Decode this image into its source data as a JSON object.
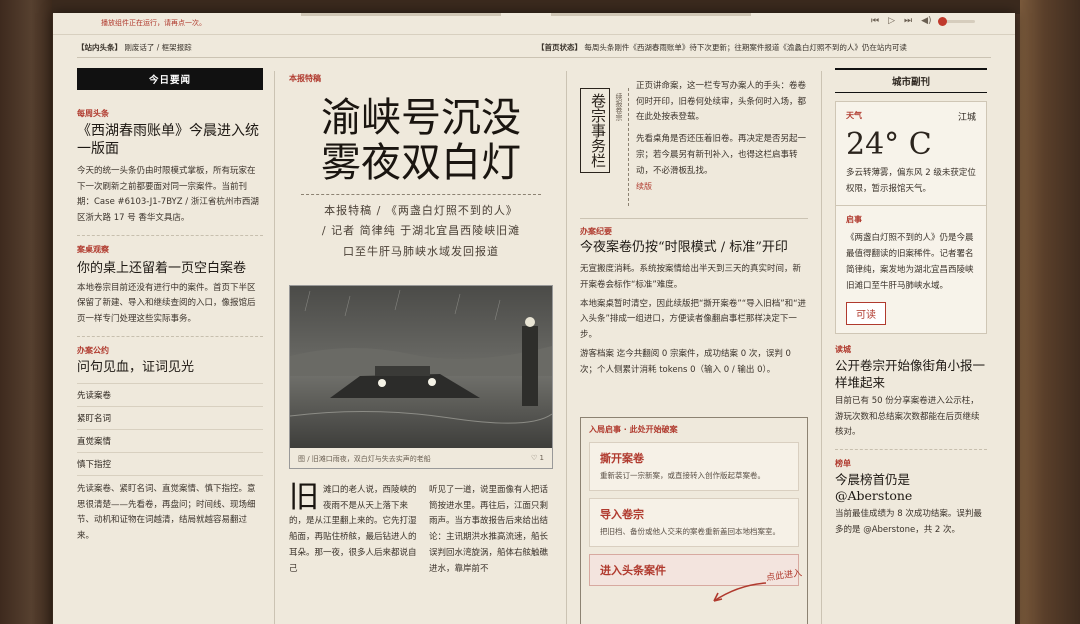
{
  "topbar": {
    "note": "播放组件正在运行，请再点一次。"
  },
  "player": {
    "prev": "⏮",
    "play": "▷",
    "next": "⏭",
    "volume_icon": "◀)"
  },
  "ticker": {
    "left_label": "【站内头条】",
    "left_text": "刚废话了 / 框架报踪",
    "right_label": "【首页状态】",
    "right_text": "每周头条刚件《西湖春雨账单》待下次更新；往期案件报道《渝蠡白灯照不到的人》仍在站内可读"
  },
  "left": {
    "section": "今日要闻",
    "blocks": [
      {
        "tag": "每周头条",
        "title": "《西湖春雨账单》今晨进入统一版面",
        "body": "今天的统一头条仍由时限模式掌板，所有玩家在下一次刷新之前都要面对同一宗案件。当前刊期：Case #6103-J1-7BYZ / 浙江省杭州市西湖区浙大路 17 号 香华文具店。"
      },
      {
        "tag": "案桌观察",
        "title": "你的桌上还留着一页空白案卷",
        "body": "本地卷宗目前还没有进行中的案件。首页下半区保留了新建、导入和继续查阅的入口，像报馆后页一样专门处理这些实际事务。"
      },
      {
        "tag": "办案公约",
        "title": "问句见血，证词见光",
        "body": ""
      }
    ],
    "list": [
      "先读案卷",
      "紧盯名词",
      "直觉案情",
      "慎下指控"
    ],
    "tail": "先读案卷、紧盯名词、直觉案情、慎下指控。意思很清楚——先看卷，再盘问；时间线、现场细节、动机和证物在词越清，结局就越容易翻过来。"
  },
  "feature": {
    "tag": "本报特稿",
    "headline_1": "渝峡号沉没",
    "headline_2": "雾夜双白灯",
    "byline_1": "本报特稿 / 《两盏白灯照不到的人》",
    "byline_2": "/ 记者 简律纯 于湖北宜昌西陵峡旧滩",
    "byline_3": "口至牛肝马肺峡水域发回报道",
    "photo_caption": "图 / 旧滩口雨夜，双白灯与失去实声的老船",
    "photo_stat": "♡  1",
    "dropcap": "旧",
    "col1": "滩口的老人说，西陵峡的夜雨不是从天上落下来的，是从江里翻上来的。它先打湿船面，再贴住桥舷，最后钻进人的耳朵。那一夜，很多人后来都说自己",
    "col2": "听见了一道，说里面像有人把话筒按进水里。再往后，江面只剩雨声。当方事故报告后来给出结论：主讯期洪水推高流速，船长误判回水湾旋涡，船体右舷触礁进水，靠岸前不"
  },
  "column": {
    "vertical_title": "卷宗事务栏",
    "vertical_sub": "续报卷宗",
    "intro_1": "正页讲命案，这一栏专写办案人的手头：卷卷何时开印，旧卷何处续审，头条何时入场，都在此处按表登载。",
    "intro_2": "先看桌角是否还压着旧卷。再决定是否另起一宗；若今晨另有新刊补入，也得这栏启事转动，不必滑板乱找。",
    "more": "续版",
    "notice_tag": "办案纪要",
    "notice_title": "今夜案卷仍按“时限模式 / 标准”开印",
    "notice_p1": "无宣搬度消耗。系统按案情给出半天到三天的真实时间，新开案卷会标作“标准”难度。",
    "notice_p2": "本地案桌暂时清空，因此续版把“撕开案卷”“导入旧档”和“进入头条”排成一组进口，方便读者像翻启事栏那样决定下一步。",
    "notice_p3": "游客档案 迄今共翻阅 0 宗案件，成功结案 0 次，误判 0 次；个人侧累计消耗 tokens 0（输入 0 / 输出 0）。",
    "entry_head": "入局启事 · 此处开始破案",
    "cards": [
      {
        "title": "撕开案卷",
        "desc": "重新装订一宗新案，或直接转入创作版起草案卷。"
      },
      {
        "title": "导入卷宗",
        "desc": "把旧档、备份或他人交来的案卷重新盖回本地档案室。"
      },
      {
        "title": "进入头条案件",
        "desc": ""
      }
    ],
    "annotation": "点此进入"
  },
  "right": {
    "section": "城市副刊",
    "weather_tag": "天气",
    "weather_city": "江城",
    "temp": "24°  C",
    "weather_desc": "多云转薄雾，偏东风 2 级未获定位权限，暂示报馆天气。",
    "notice_tag": "启事",
    "notice_body": "《两盏白灯照不到的人》仍是今晨最值得翻读的旧案稀件。记者署名 简律纯，案发地为湖北宜昌西陵峡旧滩口至牛肝马肺峡水域。",
    "notice_btn": "可读",
    "reader_tag": "读城",
    "reader_title": "公开卷宗开始像街角小报一样堆起来",
    "reader_body": "目前已有 50 份分享案卷进入公示柱，游玩次数和总结案次数都能在后页继续核对。",
    "rank_tag": "榜单",
    "rank_title": "今晨榜首仍是 @Aberstone",
    "rank_body": "当前最佳成绩为 8 次成功结案。误判最多的是 @Aberstone，共 2 次。"
  }
}
